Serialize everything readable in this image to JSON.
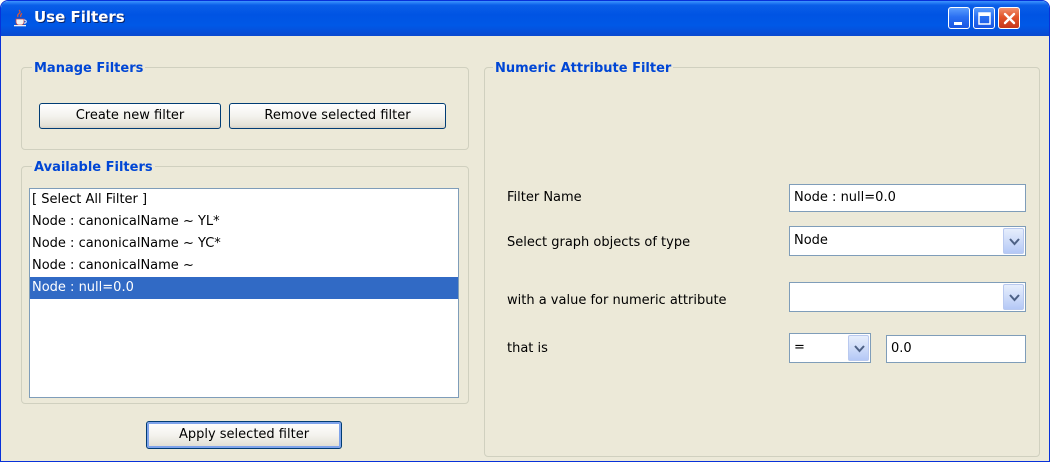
{
  "window": {
    "title": "Use Filters"
  },
  "manage_filters": {
    "legend": "Manage Filters",
    "create_button": "Create new filter",
    "remove_button": "Remove selected filter"
  },
  "available_filters": {
    "legend": "Available Filters",
    "items": [
      {
        "label": "[ Select All Filter ]",
        "selected": false
      },
      {
        "label": "Node : canonicalName ~ YL*",
        "selected": false
      },
      {
        "label": "Node : canonicalName ~ YC*",
        "selected": false
      },
      {
        "label": "Node : canonicalName ~",
        "selected": false
      },
      {
        "label": "Node : null=0.0",
        "selected": true
      }
    ],
    "apply_button": "Apply selected filter"
  },
  "numeric_filter": {
    "legend": "Numeric Attribute Filter",
    "filter_name_label": "Filter Name",
    "filter_name_value": "Node : null=0.0",
    "object_type_label": "Select graph objects of type",
    "object_type_value": "Node",
    "attribute_label": " with a value for numeric attribute",
    "attribute_value": "",
    "that_is_label": " that is",
    "operator_value": "=",
    "threshold_value": "0.0"
  },
  "colors": {
    "titlebar": "#0054e3",
    "legend_text": "#0046d5",
    "selection": "#316ac5",
    "window_bg": "#ece9d8"
  },
  "icons": {
    "app": "java-cup-icon",
    "minimize": "minimize-icon",
    "maximize": "maximize-icon",
    "close": "close-icon",
    "dropdown": "chevron-down-icon"
  }
}
